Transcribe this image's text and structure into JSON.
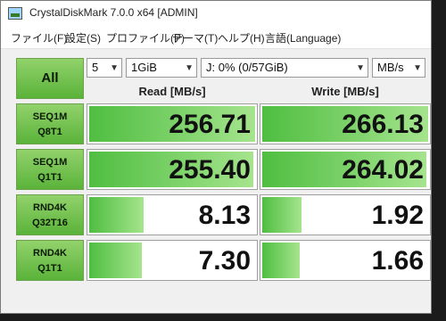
{
  "window": {
    "title": "CrystalDiskMark 7.0.0 x64 [ADMIN]"
  },
  "menu": [
    "ファイル(F)",
    "設定(S)",
    "プロファイル(P)",
    "テーマ(T)",
    "ヘルプ(H)",
    "言語(Language)"
  ],
  "controls": {
    "all_label": "All",
    "count": "5",
    "size": "1GiB",
    "drive": "J: 0% (0/57GiB)",
    "unit": "MB/s"
  },
  "headers": {
    "read": "Read [MB/s]",
    "write": "Write [MB/s]"
  },
  "rows": [
    {
      "line1": "SEQ1M",
      "line2": "Q8T1",
      "read": "256.71",
      "write": "266.13",
      "read_fill": 1.0,
      "write_fill": 1.0
    },
    {
      "line1": "SEQ1M",
      "line2": "Q1T1",
      "read": "255.40",
      "write": "264.02",
      "read_fill": 0.99,
      "write_fill": 0.99
    },
    {
      "line1": "RND4K",
      "line2": "Q32T16",
      "read": "8.13",
      "write": "1.92",
      "read_fill": 0.34,
      "write_fill": 0.25
    },
    {
      "line1": "RND4K",
      "line2": "Q1T1",
      "read": "7.30",
      "write": "1.66",
      "read_fill": 0.33,
      "write_fill": 0.24
    }
  ]
}
